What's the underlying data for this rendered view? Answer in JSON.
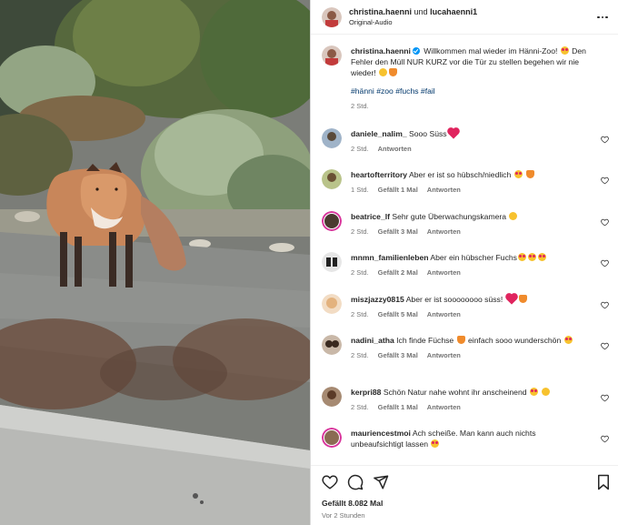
{
  "header": {
    "user1": "christina.haenni",
    "joiner": "und",
    "user2": "lucahaenni1",
    "audio": "Original-Audio"
  },
  "caption": {
    "username": "christina.haenni",
    "text": "Willkommen mal wieder im Hänni-Zoo!",
    "text2": "Den Fehler den Müll NUR KURZ vor die Tür zu stellen begehen wir nie wieder!",
    "tags": "#hänni #zoo #fuchs #fail",
    "time": "2 Std."
  },
  "comments": [
    {
      "user": "daniele_nalim_",
      "text": "Sooo Süss",
      "time": "2 Std.",
      "likes": "",
      "reply": "Antworten"
    },
    {
      "user": "heartofterritory",
      "text": "Aber er ist so hübsch/niedlich",
      "time": "1 Std.",
      "likes": "Gefällt 1 Mal",
      "reply": "Antworten"
    },
    {
      "user": "beatrice_lf",
      "text": "Sehr gute Überwachungskamera",
      "time": "2 Std.",
      "likes": "Gefällt 3 Mal",
      "reply": "Antworten"
    },
    {
      "user": "mnmn_familienleben",
      "text": "Aber ein hübscher Fuchs",
      "time": "2 Std.",
      "likes": "Gefällt 2 Mal",
      "reply": "Antworten"
    },
    {
      "user": "miszjazzy0815",
      "text": "Aber er ist soooooooo süss!",
      "time": "2 Std.",
      "likes": "Gefällt 5 Mal",
      "reply": "Antworten"
    },
    {
      "user": "nadini_atha",
      "text": "Ich finde Füchse",
      "text2": "einfach sooo wunderschön",
      "time": "2 Std.",
      "likes": "Gefällt 3 Mal",
      "reply": "Antworten"
    },
    {
      "user": "kerpri88",
      "text": "Schön Natur nahe wohnt ihr anscheinend",
      "time": "2 Std.",
      "likes": "Gefällt 1 Mal",
      "reply": "Antworten"
    },
    {
      "user": "mauriencestmoi",
      "text": "Ach scheiße. Man kann auch nichts unbeaufsichtigt lassen",
      "time": "",
      "likes": "",
      "reply": ""
    }
  ],
  "footer": {
    "likes": "Gefällt 8.082 Mal",
    "time": "Vor 2 Stunden"
  },
  "colors": {
    "link": "#00376b",
    "verified": "#0095f6",
    "muted": "#737373"
  },
  "icons": [
    "heart-icon",
    "comment-icon",
    "share-icon",
    "bookmark-icon",
    "more-icon"
  ]
}
